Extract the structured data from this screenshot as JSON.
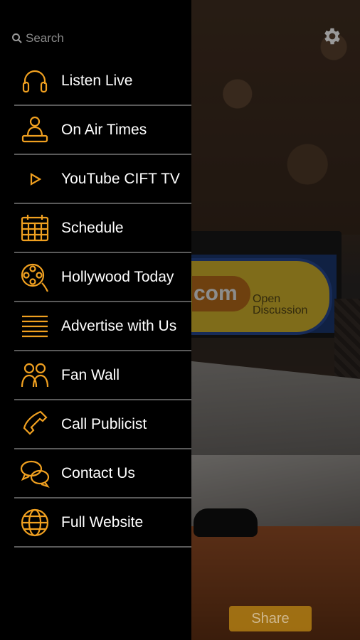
{
  "search": {
    "placeholder": "Search",
    "icon": "search-icon"
  },
  "accent_color": "#f0a020",
  "menu": {
    "items": [
      {
        "label": "Listen Live",
        "icon": "headphones-icon"
      },
      {
        "label": "On Air Times",
        "icon": "person-at-desk-icon"
      },
      {
        "label": "YouTube CIFT TV",
        "icon": "play-icon"
      },
      {
        "label": "Schedule",
        "icon": "calendar-icon"
      },
      {
        "label": "Hollywood Today",
        "icon": "film-reel-icon"
      },
      {
        "label": "Advertise with Us",
        "icon": "lines-icon"
      },
      {
        "label": "Fan Wall",
        "icon": "people-icon"
      },
      {
        "label": "Call Publicist",
        "icon": "phone-icon"
      },
      {
        "label": "Contact Us",
        "icon": "chat-bubbles-icon"
      },
      {
        "label": "Full Website",
        "icon": "globe-icon"
      }
    ]
  },
  "background": {
    "monitor_text": "com",
    "monitor_subtext": [
      "Open",
      "Discussion"
    ]
  },
  "share_button": {
    "label": "Share"
  },
  "settings": {
    "icon": "gear-icon"
  }
}
